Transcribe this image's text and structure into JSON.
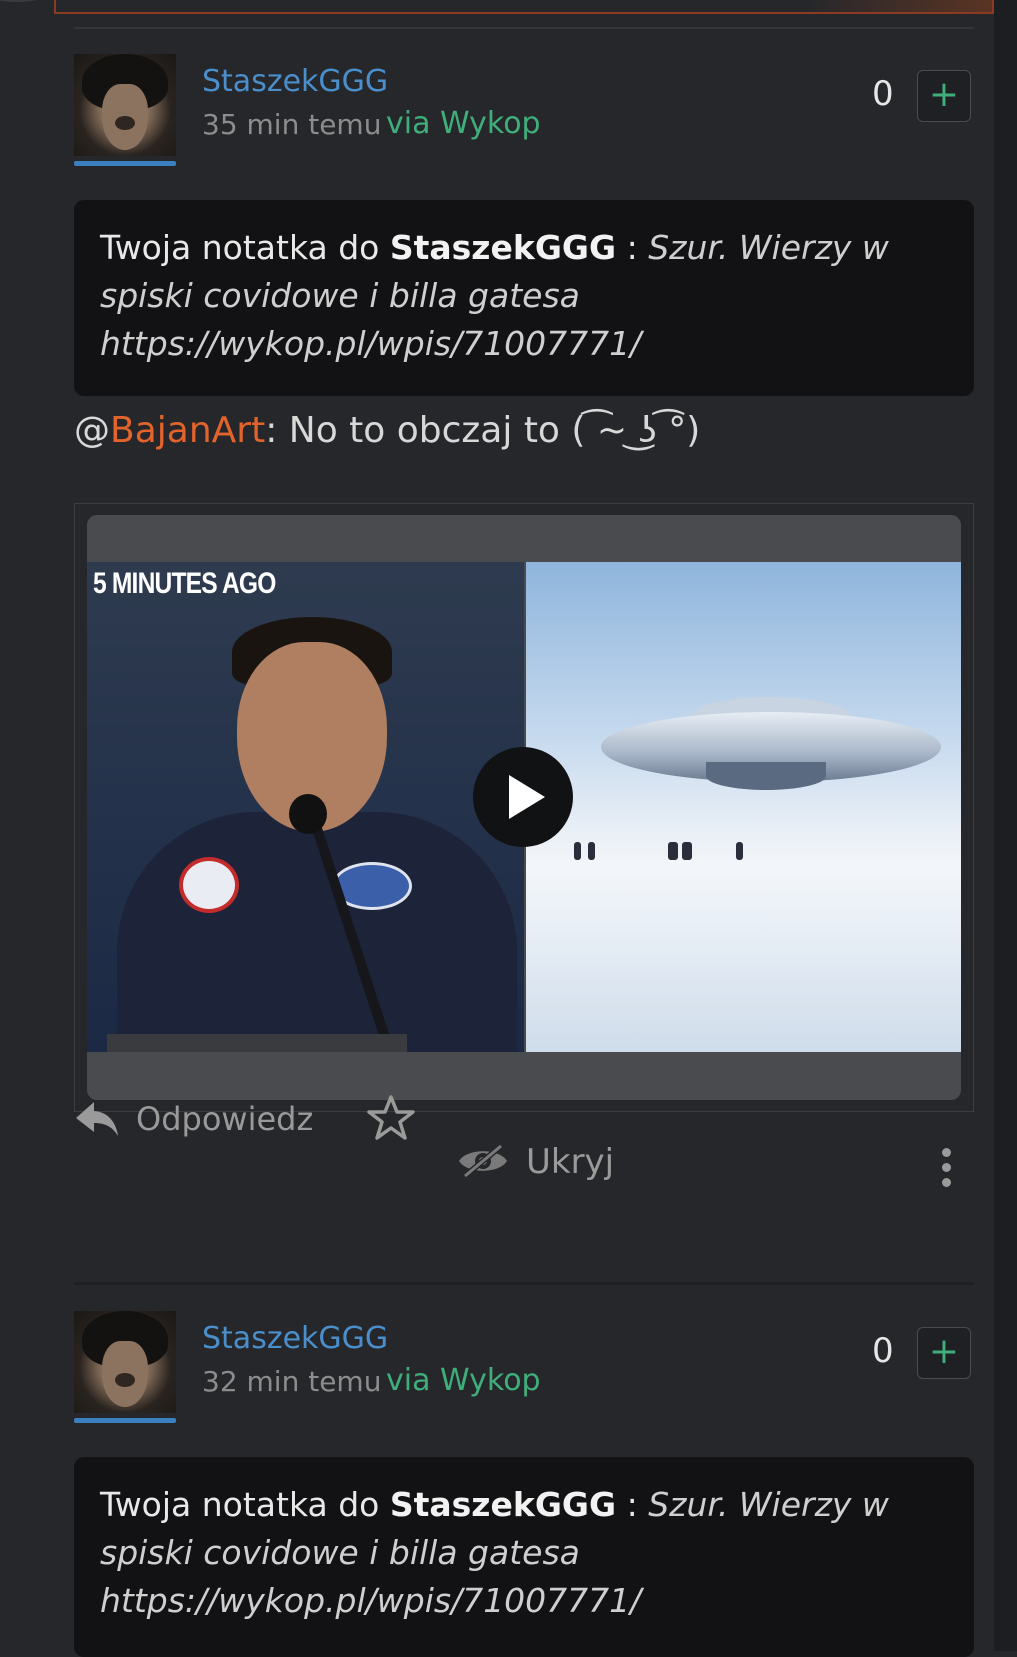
{
  "entries": [
    {
      "username": "StaszekGGG",
      "time": "35 min temu",
      "via": "via Wykop",
      "votes": "0",
      "plus": "+",
      "note_prefix": "Twoja notatka do ",
      "note_user": "StaszekGGG",
      "note_sep": " : ",
      "note_text": "Szur. Wierzy w spiski covidowe i billa gatesa https://wykop.pl/wpis/71007771/",
      "mention_at": "@",
      "mention_user": "BajanArt",
      "message": ": No to obczaj to ( ͡~ ͜ʖ ͡°)",
      "video_caption": "5 MINUTES AGO",
      "actions": {
        "reply": "Odpowiedz",
        "hide": "Ukryj"
      }
    },
    {
      "username": "StaszekGGG",
      "time": "32 min temu",
      "via": "via Wykop",
      "votes": "0",
      "plus": "+",
      "note_prefix": "Twoja notatka do ",
      "note_user": "StaszekGGG",
      "note_sep": " : ",
      "note_text": "Szur. Wierzy w spiski covidowe i billa gatesa https://wykop.pl/wpis/71007771/"
    }
  ],
  "icons": {
    "reply": "reply-icon",
    "favorite": "star-icon",
    "hide": "eye-slash-icon",
    "more": "more-vertical-icon",
    "play": "play-icon"
  },
  "colors": {
    "background": "#26272b",
    "username": "#4a8fcb",
    "via": "#3fae7a",
    "mention": "#e2632b",
    "note_bg": "#121214"
  }
}
